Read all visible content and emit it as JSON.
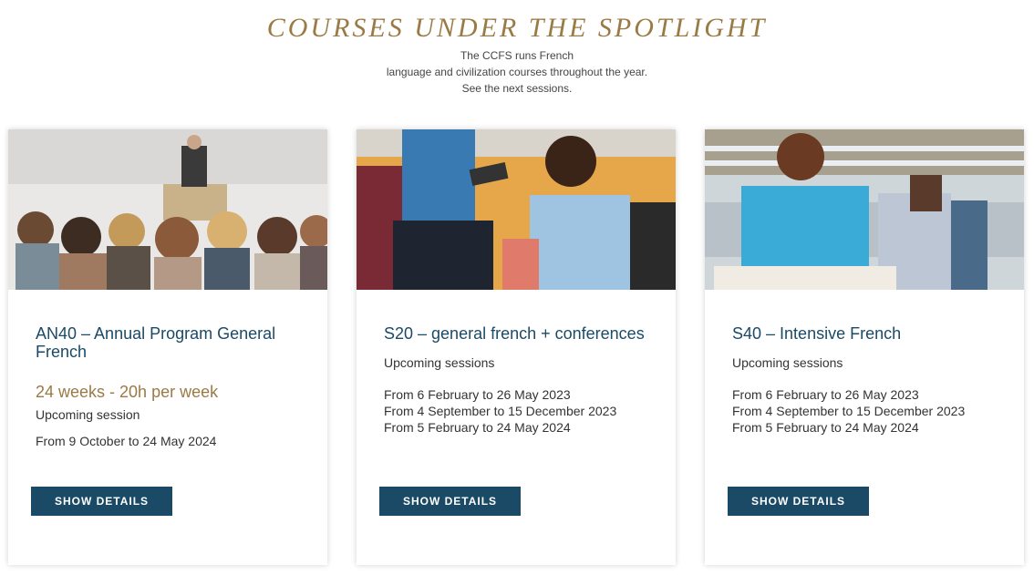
{
  "header": {
    "title": "COURSES UNDER THE SPOTLIGHT",
    "intro_lines": [
      "The CCFS runs French",
      "language and civilization courses throughout the year.",
      "See the next sessions."
    ]
  },
  "cards": [
    {
      "title": "AN40 – Annual Program General French",
      "duration": "24 weeks - 20h  per week",
      "sessions_label": "Upcoming session",
      "sessions": [
        "From 9 October to 24 May 2024"
      ],
      "button": "SHOW DETAILS"
    },
    {
      "title": "S20 – general french + conferences",
      "sessions_label": "Upcoming sessions",
      "sessions": [
        "From 6 February to 26 May 2023",
        "From 4 September to 15 December 2023",
        "From 5 February to 24 May 2024"
      ],
      "button": "SHOW DETAILS"
    },
    {
      "title": "S40 – Intensive French",
      "sessions_label": "Upcoming sessions",
      "sessions": [
        "From 6 February to 26 May 2023",
        "From 4 September to 15 December 2023",
        "From 5 February to 24 May 2024"
      ],
      "button": "SHOW DETAILS"
    }
  ],
  "colors": {
    "accent_gold": "#9a7a45",
    "primary_navy": "#1a4a66"
  }
}
